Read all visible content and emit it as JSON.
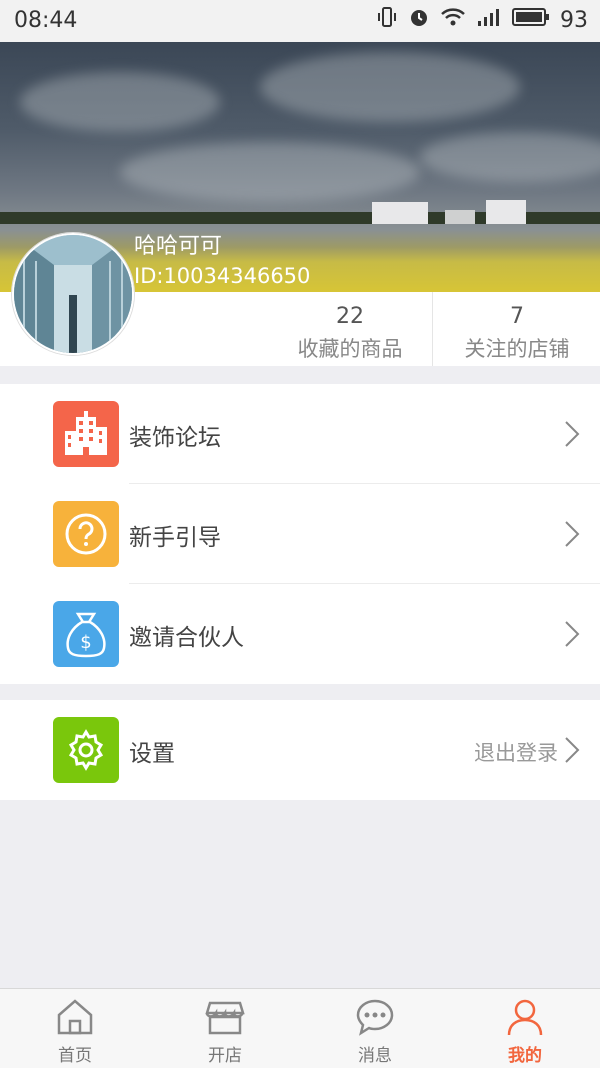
{
  "status_bar": {
    "time": "08:44",
    "battery": "93"
  },
  "profile": {
    "username": "哈哈可可",
    "user_id": "ID:10034346650"
  },
  "stats": [
    {
      "count": "22",
      "label": "收藏的商品"
    },
    {
      "count": "7",
      "label": "关注的店铺"
    }
  ],
  "menu": [
    {
      "label": "装饰论坛",
      "icon": "building-icon",
      "color": "#f4654a"
    },
    {
      "label": "新手引导",
      "icon": "question-icon",
      "color": "#f7b23b"
    },
    {
      "label": "邀请合伙人",
      "icon": "money-bag-icon",
      "color": "#4aa7e8"
    }
  ],
  "settings": {
    "label": "设置",
    "logout": "退出登录",
    "icon": "gear-icon",
    "color": "#7ac70c"
  },
  "tabs": [
    {
      "label": "首页",
      "icon": "home-icon"
    },
    {
      "label": "开店",
      "icon": "store-icon"
    },
    {
      "label": "消息",
      "icon": "chat-icon"
    },
    {
      "label": "我的",
      "icon": "person-icon"
    }
  ],
  "colors": {
    "accent": "#f2663e"
  }
}
